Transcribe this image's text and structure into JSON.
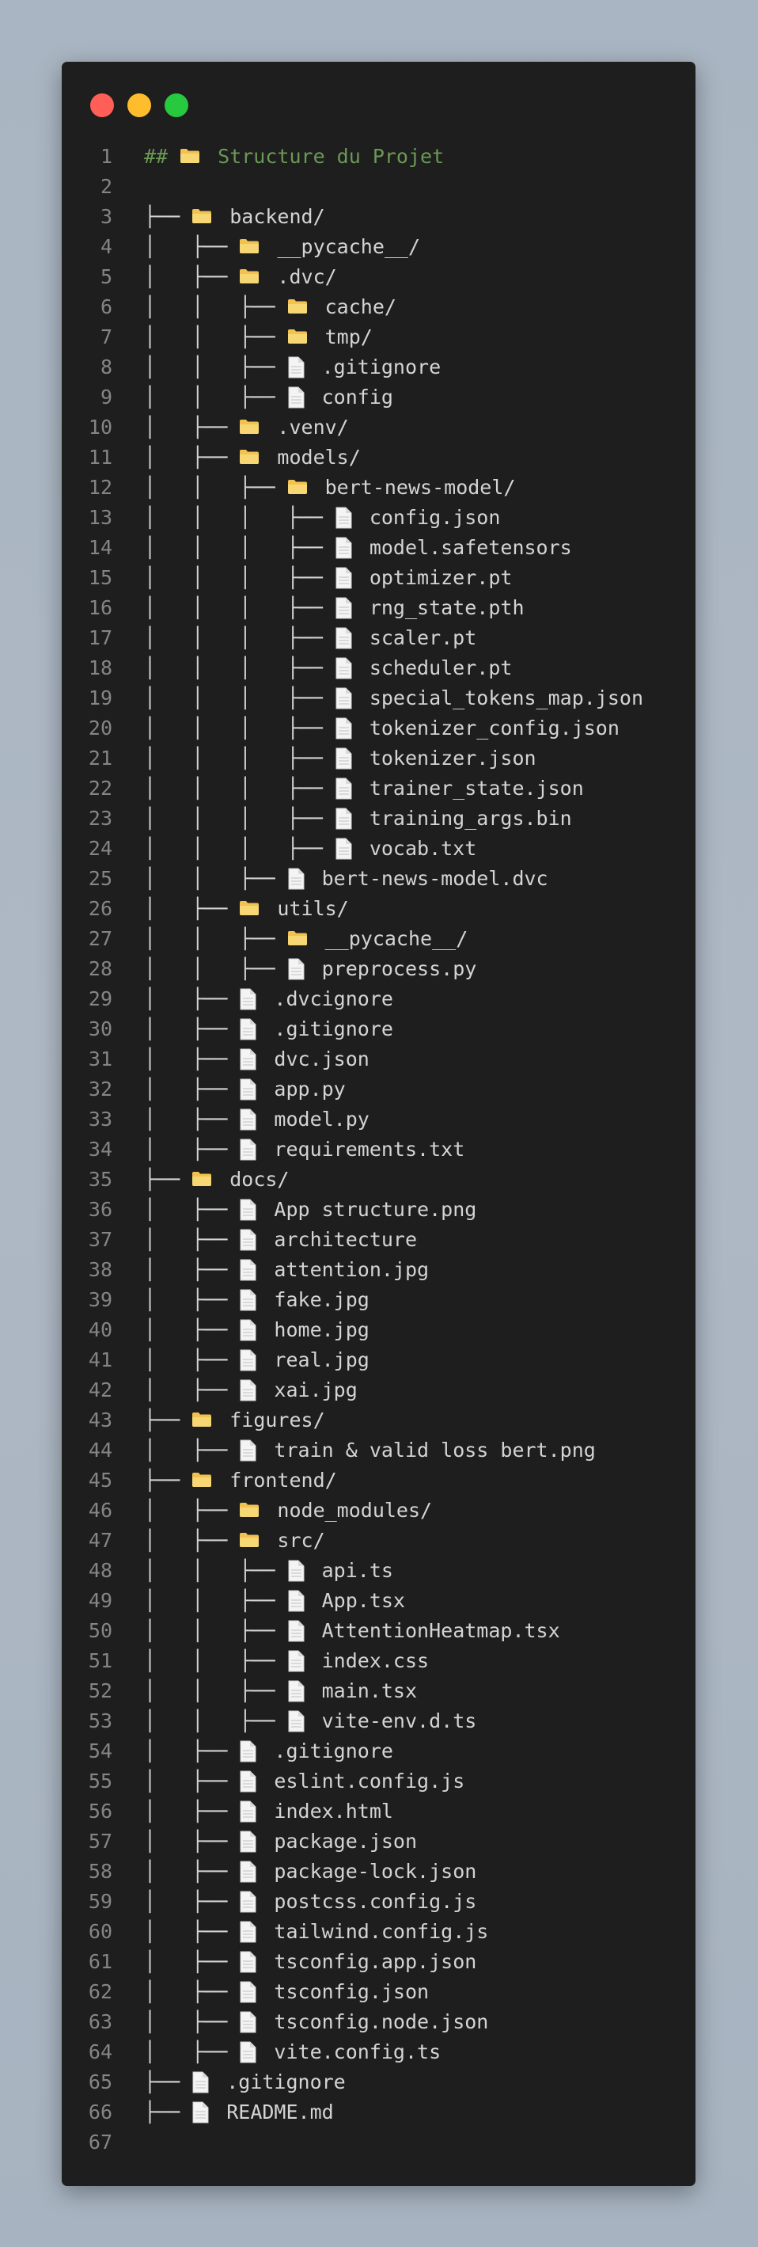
{
  "window": {
    "controls": [
      {
        "name": "close-button",
        "color": "#ff5f56"
      },
      {
        "name": "minimize-button",
        "color": "#ffbd2e"
      },
      {
        "name": "maximize-button",
        "color": "#27c93f"
      }
    ]
  },
  "colors": {
    "background": "#1e1e1e",
    "heading": "#6a9955",
    "text": "#d4d4d4",
    "line_number": "#858585",
    "folder": "#f2c14e"
  },
  "lines": [
    {
      "n": "1",
      "heading": "## ",
      "icon": "folder",
      "name": "Structure du Projet"
    },
    {
      "n": "2",
      "prefix": "",
      "icon": "",
      "name": ""
    },
    {
      "n": "3",
      "prefix": "├── ",
      "icon": "folder",
      "name": "backend/"
    },
    {
      "n": "4",
      "prefix": "│   ├── ",
      "icon": "folder",
      "name": "__pycache__/"
    },
    {
      "n": "5",
      "prefix": "│   ├── ",
      "icon": "folder",
      "name": ".dvc/"
    },
    {
      "n": "6",
      "prefix": "│   │   ├── ",
      "icon": "folder",
      "name": "cache/"
    },
    {
      "n": "7",
      "prefix": "│   │   ├── ",
      "icon": "folder",
      "name": "tmp/"
    },
    {
      "n": "8",
      "prefix": "│   │   ├── ",
      "icon": "file",
      "name": ".gitignore"
    },
    {
      "n": "9",
      "prefix": "│   │   ├── ",
      "icon": "file",
      "name": "config"
    },
    {
      "n": "10",
      "prefix": "│   ├── ",
      "icon": "folder",
      "name": ".venv/"
    },
    {
      "n": "11",
      "prefix": "│   ├── ",
      "icon": "folder",
      "name": "models/"
    },
    {
      "n": "12",
      "prefix": "│   │   ├── ",
      "icon": "folder",
      "name": "bert-news-model/"
    },
    {
      "n": "13",
      "prefix": "│   │   │   ├── ",
      "icon": "file",
      "name": "config.json"
    },
    {
      "n": "14",
      "prefix": "│   │   │   ├── ",
      "icon": "file",
      "name": "model.safetensors"
    },
    {
      "n": "15",
      "prefix": "│   │   │   ├── ",
      "icon": "file",
      "name": "optimizer.pt"
    },
    {
      "n": "16",
      "prefix": "│   │   │   ├── ",
      "icon": "file",
      "name": "rng_state.pth"
    },
    {
      "n": "17",
      "prefix": "│   │   │   ├── ",
      "icon": "file",
      "name": "scaler.pt"
    },
    {
      "n": "18",
      "prefix": "│   │   │   ├── ",
      "icon": "file",
      "name": "scheduler.pt"
    },
    {
      "n": "19",
      "prefix": "│   │   │   ├── ",
      "icon": "file",
      "name": "special_tokens_map.json"
    },
    {
      "n": "20",
      "prefix": "│   │   │   ├── ",
      "icon": "file",
      "name": "tokenizer_config.json"
    },
    {
      "n": "21",
      "prefix": "│   │   │   ├── ",
      "icon": "file",
      "name": "tokenizer.json"
    },
    {
      "n": "22",
      "prefix": "│   │   │   ├── ",
      "icon": "file",
      "name": "trainer_state.json"
    },
    {
      "n": "23",
      "prefix": "│   │   │   ├── ",
      "icon": "file",
      "name": "training_args.bin"
    },
    {
      "n": "24",
      "prefix": "│   │   │   ├── ",
      "icon": "file",
      "name": "vocab.txt"
    },
    {
      "n": "25",
      "prefix": "│   │   ├── ",
      "icon": "file",
      "name": "bert-news-model.dvc"
    },
    {
      "n": "26",
      "prefix": "│   ├── ",
      "icon": "folder",
      "name": "utils/"
    },
    {
      "n": "27",
      "prefix": "│   │   ├── ",
      "icon": "folder",
      "name": "__pycache__/"
    },
    {
      "n": "28",
      "prefix": "│   │   ├── ",
      "icon": "file",
      "name": "preprocess.py"
    },
    {
      "n": "29",
      "prefix": "│   ├── ",
      "icon": "file",
      "name": ".dvcignore"
    },
    {
      "n": "30",
      "prefix": "│   ├── ",
      "icon": "file",
      "name": ".gitignore"
    },
    {
      "n": "31",
      "prefix": "│   ├── ",
      "icon": "file",
      "name": "dvc.json"
    },
    {
      "n": "32",
      "prefix": "│   ├── ",
      "icon": "file",
      "name": "app.py"
    },
    {
      "n": "33",
      "prefix": "│   ├── ",
      "icon": "file",
      "name": "model.py"
    },
    {
      "n": "34",
      "prefix": "│   ├── ",
      "icon": "file",
      "name": "requirements.txt"
    },
    {
      "n": "35",
      "prefix": "├── ",
      "icon": "folder",
      "name": "docs/"
    },
    {
      "n": "36",
      "prefix": "│   ├── ",
      "icon": "file",
      "name": "App structure.png"
    },
    {
      "n": "37",
      "prefix": "│   ├── ",
      "icon": "file",
      "name": "architecture"
    },
    {
      "n": "38",
      "prefix": "│   ├── ",
      "icon": "file",
      "name": "attention.jpg"
    },
    {
      "n": "39",
      "prefix": "│   ├── ",
      "icon": "file",
      "name": "fake.jpg"
    },
    {
      "n": "40",
      "prefix": "│   ├── ",
      "icon": "file",
      "name": "home.jpg"
    },
    {
      "n": "41",
      "prefix": "│   ├── ",
      "icon": "file",
      "name": "real.jpg"
    },
    {
      "n": "42",
      "prefix": "│   ├── ",
      "icon": "file",
      "name": "xai.jpg"
    },
    {
      "n": "43",
      "prefix": "├── ",
      "icon": "folder",
      "name": "figures/"
    },
    {
      "n": "44",
      "prefix": "│   ├── ",
      "icon": "file",
      "name": "train & valid loss bert.png"
    },
    {
      "n": "45",
      "prefix": "├── ",
      "icon": "folder",
      "name": "frontend/"
    },
    {
      "n": "46",
      "prefix": "│   ├── ",
      "icon": "folder",
      "name": "node_modules/"
    },
    {
      "n": "47",
      "prefix": "│   ├── ",
      "icon": "folder",
      "name": "src/"
    },
    {
      "n": "48",
      "prefix": "│   │   ├── ",
      "icon": "file",
      "name": "api.ts"
    },
    {
      "n": "49",
      "prefix": "│   │   ├── ",
      "icon": "file",
      "name": "App.tsx"
    },
    {
      "n": "50",
      "prefix": "│   │   ├── ",
      "icon": "file",
      "name": "AttentionHeatmap.tsx"
    },
    {
      "n": "51",
      "prefix": "│   │   ├── ",
      "icon": "file",
      "name": "index.css"
    },
    {
      "n": "52",
      "prefix": "│   │   ├── ",
      "icon": "file",
      "name": "main.tsx"
    },
    {
      "n": "53",
      "prefix": "│   │   ├── ",
      "icon": "file",
      "name": "vite-env.d.ts"
    },
    {
      "n": "54",
      "prefix": "│   ├── ",
      "icon": "file",
      "name": ".gitignore"
    },
    {
      "n": "55",
      "prefix": "│   ├── ",
      "icon": "file",
      "name": "eslint.config.js"
    },
    {
      "n": "56",
      "prefix": "│   ├── ",
      "icon": "file",
      "name": "index.html"
    },
    {
      "n": "57",
      "prefix": "│   ├── ",
      "icon": "file",
      "name": "package.json"
    },
    {
      "n": "58",
      "prefix": "│   ├── ",
      "icon": "file",
      "name": "package-lock.json"
    },
    {
      "n": "59",
      "prefix": "│   ├── ",
      "icon": "file",
      "name": "postcss.config.js"
    },
    {
      "n": "60",
      "prefix": "│   ├── ",
      "icon": "file",
      "name": "tailwind.config.js"
    },
    {
      "n": "61",
      "prefix": "│   ├── ",
      "icon": "file",
      "name": "tsconfig.app.json"
    },
    {
      "n": "62",
      "prefix": "│   ├── ",
      "icon": "file",
      "name": "tsconfig.json"
    },
    {
      "n": "63",
      "prefix": "│   ├── ",
      "icon": "file",
      "name": "tsconfig.node.json"
    },
    {
      "n": "64",
      "prefix": "│   ├── ",
      "icon": "file",
      "name": "vite.config.ts"
    },
    {
      "n": "65",
      "prefix": "├── ",
      "icon": "file",
      "name": ".gitignore"
    },
    {
      "n": "66",
      "prefix": "├── ",
      "icon": "file",
      "name": "README.md"
    },
    {
      "n": "67",
      "prefix": "",
      "icon": "",
      "name": ""
    }
  ]
}
